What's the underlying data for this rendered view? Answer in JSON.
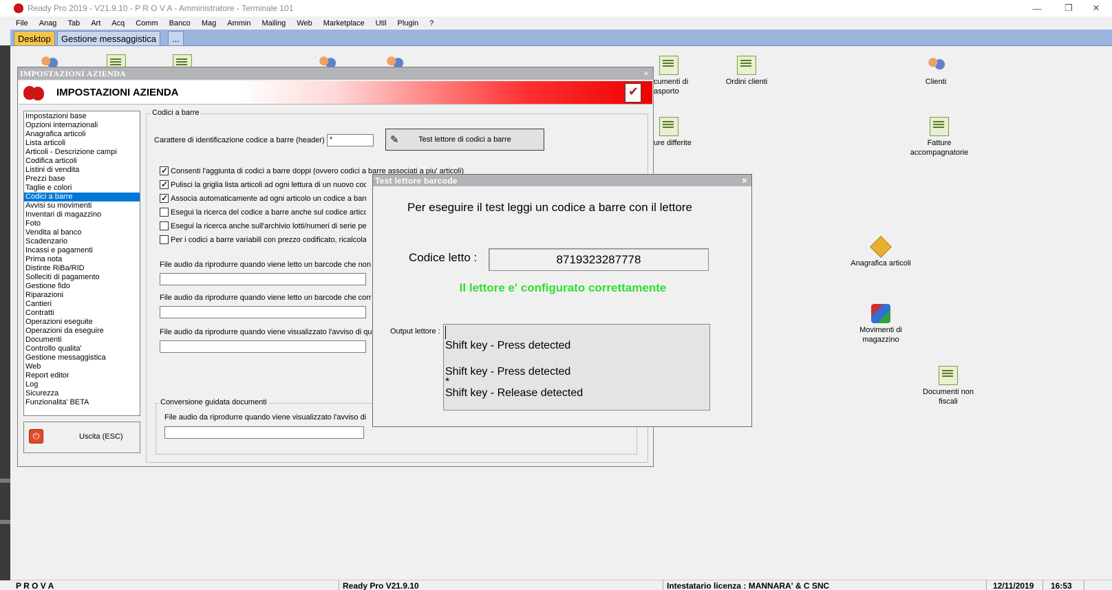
{
  "window": {
    "title": "Ready Pro 2019 - V21.9.10 - P R O V A - Amministratore - Terminale 101",
    "minimize": "—",
    "maximize": "❐",
    "close": "✕"
  },
  "menu": [
    "File",
    "Anag",
    "Tab",
    "Art",
    "Acq",
    "Comm",
    "Banco",
    "Mag",
    "Ammin",
    "Mailing",
    "Web",
    "Marketplace",
    "Util",
    "Plugin",
    "?"
  ],
  "tabs": [
    {
      "label": "Desktop"
    },
    {
      "label": "Gestione messaggistica"
    },
    {
      "label": "..."
    }
  ],
  "desktop_icons": {
    "documenti_trasporto": [
      "cumenti di",
      "asporto"
    ],
    "ordini_clienti": "Ordini clienti",
    "clienti": "Clienti",
    "fatture_differite": "ure differite",
    "fatture_accompagnatorie": [
      "Fatture",
      "accompagnatorie"
    ],
    "anagrafica_articoli": "Anagrafica articoli",
    "movimenti_magazzino": [
      "Movimenti di",
      "magazzino"
    ],
    "documenti_non_fiscali": [
      "Documenti non",
      "fiscali"
    ]
  },
  "settings_dialog": {
    "title": "IMPOSTAZIONI AZIENDA",
    "banner_title": "IMPOSTAZIONI AZIENDA",
    "close": "×",
    "nav_items": [
      "Impostazioni base",
      "Opzioni internazionali",
      "Anagrafica articoli",
      "Lista articoli",
      "Articoli - Descrizione campi",
      "Codifica articoli",
      "Listini di vendita",
      "Prezzi base",
      "Taglie e colori",
      "Codici a barre",
      "Avvisi su movimenti",
      "Inventari di magazzino",
      "Foto",
      "Vendita al banco",
      "Scadenzario",
      "Incassi e pagamenti",
      "Prima nota",
      "Distinte RiBa/RID",
      "Solleciti di pagamento",
      "Gestione fido",
      "Riparazioni",
      "Cantieri",
      "Contratti",
      "Operazioni eseguite",
      "Operazioni da eseguire",
      "Documenti",
      "Controllo qualita'",
      "Gestione messaggistica",
      "Web",
      "Report editor",
      "Log",
      "Sicurezza",
      "Funzionalita' BETA"
    ],
    "selected_index": 9,
    "exit_button": "Uscita (ESC)",
    "group_title": "Codici a barre",
    "header_label": "Carattere di identificazione codice a barre (header) :",
    "header_value": "*",
    "test_button": "Test lettore di codici a barre",
    "checkboxes": [
      {
        "label": "Consenti l'aggiunta di codici a barre doppi (ovvero codici a barre associati a piu' articoli)",
        "checked": true
      },
      {
        "label": "Pulisci la griglia lista articoli ad ogni lettura di un nuovo codice",
        "checked": true
      },
      {
        "label": "Associa automaticamente ad ogni articolo un codice a barre",
        "checked": true
      },
      {
        "label": "Esegui la ricerca del codice a barre anche sul codice articolo",
        "checked": false
      },
      {
        "label": "Esegui la ricerca anche sull'archivio lotti/numeri di serie per l",
        "checked": false
      },
      {
        "label": "Per i codici a barre variabili con prezzo codificato, ricalcola le",
        "checked": false
      }
    ],
    "audio_label_1": "File audio da riprodurre quando viene letto un barcode che non",
    "audio_label_2": "File audio da riprodurre quando viene letto un barcode che corr",
    "audio_label_3": "File audio da riprodurre quando viene visualizzato l'avviso di qu",
    "conversion_group": "Conversione guidata documenti",
    "conversion_label": "File audio da riprodurre quando viene visualizzato l'avviso di"
  },
  "barcode_dialog": {
    "title": "Test lettore barcode",
    "close": "×",
    "instruction": "Per eseguire il test leggi un codice a barre con il lettore",
    "code_label": "Codice letto :",
    "code_value": "8719323287778",
    "status_ok": "Il lettore e' configurato correttamente",
    "output_label": "Output lettore :",
    "output_lines": [
      "",
      "Shift key - Press detected",
      "",
      "Shift key - Press detected",
      "*",
      "Shift key - Release detected"
    ]
  },
  "statusbar": {
    "db": "P R O V A",
    "version": "Ready Pro V21.9.10",
    "license": "Intestatario licenza : MANNARA' & C SNC",
    "date": "12/11/2019",
    "time": "16:53"
  }
}
